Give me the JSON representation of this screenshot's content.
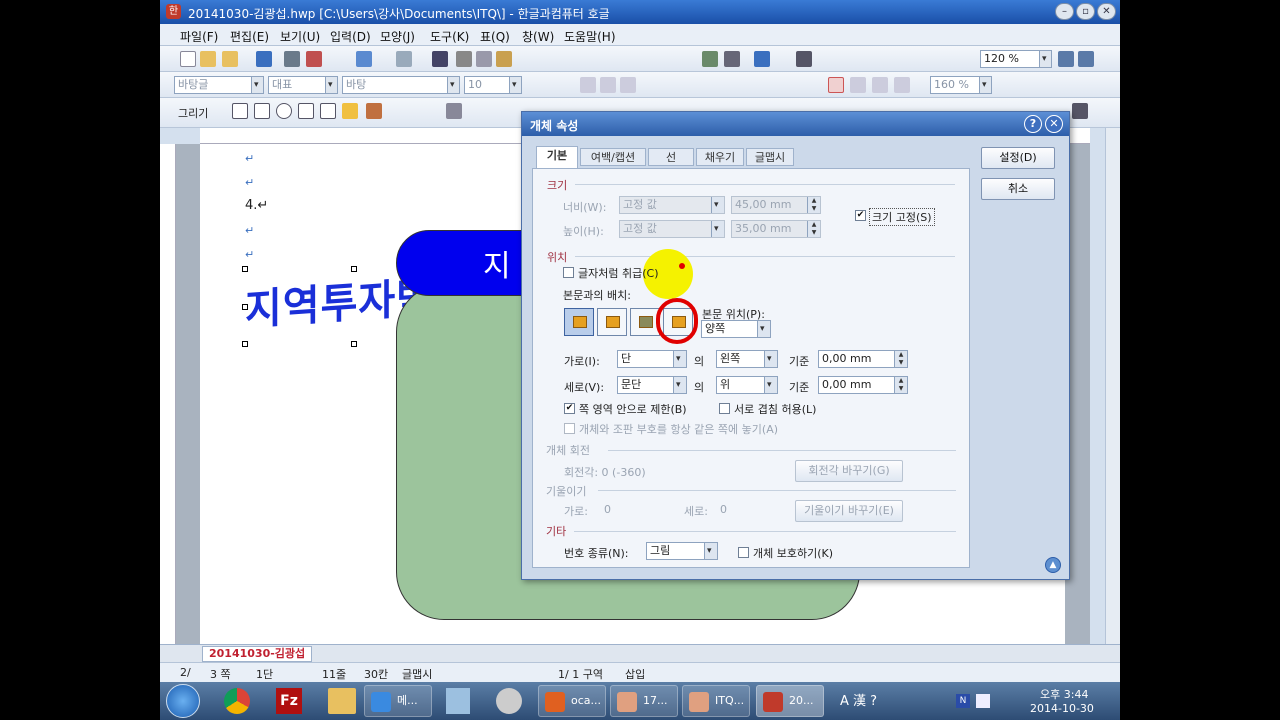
{
  "window": {
    "title": "20141030-김광섭.hwp [C:\\Users\\강사\\Documents\\ITQ\\] - 한글과컴퓨터 호글",
    "app_icon": "한"
  },
  "menu": [
    "파일(F)",
    "편집(E)",
    "보기(U)",
    "입력(D)",
    "모양(J)",
    "도구(K)",
    "표(Q)",
    "창(W)",
    "도움말(H)"
  ],
  "toolbar": {
    "zoom": "120 %",
    "style": "바탕글",
    "lang": "대표",
    "font": "바탕",
    "size": "10",
    "line_spacing": "160 %",
    "draw_label": "그리기"
  },
  "document": {
    "marks": [
      "↵",
      "↵",
      "4.↵",
      "↵",
      "↵"
    ],
    "wordart": "지역투자박",
    "shape_text": "지",
    "tab_name": "20141030-김광섭"
  },
  "dialog": {
    "title": "개체 속성",
    "tabs": [
      "기본",
      "여백/캡션",
      "선",
      "채우기",
      "글맵시"
    ],
    "buttons": {
      "ok": "설정(D)",
      "cancel": "취소"
    },
    "size": {
      "heading": "크기",
      "width_label": "너비(W):",
      "width_mode": "고정 값",
      "width_value": "45,00 mm",
      "height_label": "높이(H):",
      "height_mode": "고정 값",
      "height_value": "35,00 mm",
      "fix_size": "크기 고정(S)"
    },
    "position": {
      "heading": "위치",
      "treat_as_char": "글자처럼 취급(C)",
      "wrap_label": "본문과의 배치:",
      "text_pos_label": "본문 위치(P):",
      "text_pos_value": "양쪽",
      "horiz_label": "가로(I):",
      "horiz_ref": "단",
      "horiz_of": "의",
      "horiz_align": "왼쪽",
      "horiz_base": "기준",
      "horiz_offset": "0,00 mm",
      "vert_label": "세로(V):",
      "vert_ref": "문단",
      "vert_of": "의",
      "vert_align": "위",
      "vert_base": "기준",
      "vert_offset": "0,00 mm",
      "limit_area": "쪽 영역 안으로 제한(B)",
      "allow_overlap": "서로 겹침 허용(L)",
      "keep_with_anchor": "개체와 조판 부호를 항상 같은 쪽에 놓기(A)"
    },
    "rotation": {
      "heading": "개체 회전",
      "angle": "회전각: 0 (-360)",
      "button": "회전각 바꾸기(G)"
    },
    "skew": {
      "heading": "기울이기",
      "horiz": "가로:",
      "horiz_val": "0",
      "vert": "세로:",
      "vert_val": "0",
      "button": "기울이기 바꾸기(E)"
    },
    "etc": {
      "heading": "기타",
      "num_label": "번호 종류(N):",
      "num_value": "그림",
      "protect": "개체 보호하기(K)"
    }
  },
  "status": {
    "page": "2/",
    "count": "3 쪽",
    "col": "1단",
    "line": "11줄",
    "char": "30칸",
    "mode": "글맵시",
    "section": "1/  1 구역",
    "insert": "삽입"
  },
  "taskbar": {
    "items": [
      "메...",
      "oca...",
      "17...",
      "ITQ...",
      "20..."
    ],
    "time": "오후 3:44",
    "date": "2014-10-30"
  },
  "colors": {
    "accent": "#2d5ea9",
    "wordart": "#1a2fd8",
    "shape_blue": "#0000ee",
    "shape_green": "#9cc49c",
    "annotation_red": "#e00000",
    "highlight_yellow": "#f5f200"
  }
}
